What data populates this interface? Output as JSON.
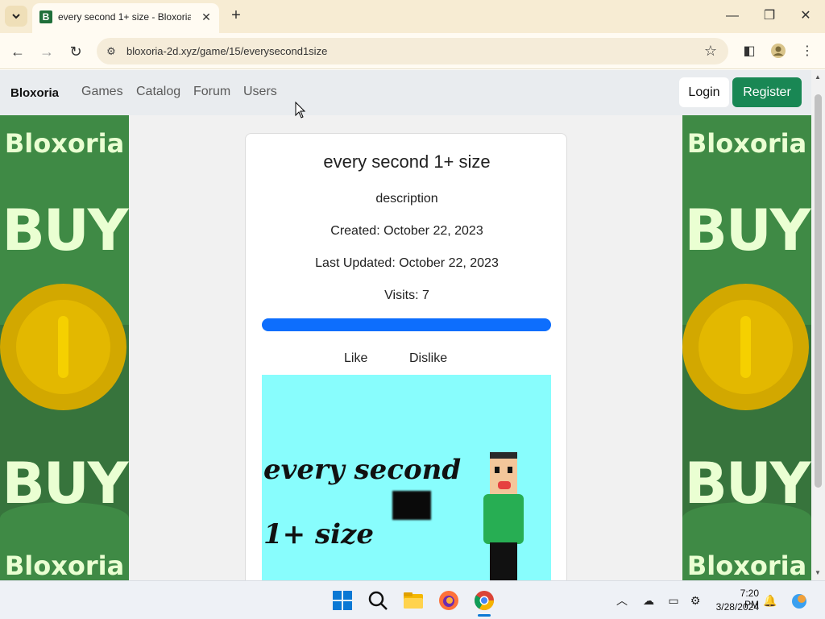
{
  "browser": {
    "tab_title": "every second 1+ size - Bloxoria",
    "favicon_letter": "B",
    "url": "bloxoria-2d.xyz/game/15/everysecond1size"
  },
  "navbar": {
    "brand": "Bloxoria",
    "links": [
      "Games",
      "Catalog",
      "Forum",
      "Users"
    ],
    "login_label": "Login",
    "register_label": "Register"
  },
  "ad": {
    "brand": "Bloxoria",
    "buy": "BUY"
  },
  "game": {
    "title": "every second 1+ size",
    "description": "description",
    "created": "Created: October 22, 2023",
    "updated": "Last Updated: October 22, 2023",
    "visits": "Visits: 7",
    "like_ratio": 1.0,
    "like_label": "Like",
    "dislike_label": "Dislike",
    "thumbnail_text_1": "every second",
    "thumbnail_text_2": "1+ size"
  },
  "taskbar": {
    "time": "7:20 PM",
    "date": "3/28/2024"
  },
  "colors": {
    "register": "#198754",
    "progress": "#0d6efd",
    "ad_green": "#3f8a45",
    "thumbnail_bg": "#88fdfd"
  }
}
